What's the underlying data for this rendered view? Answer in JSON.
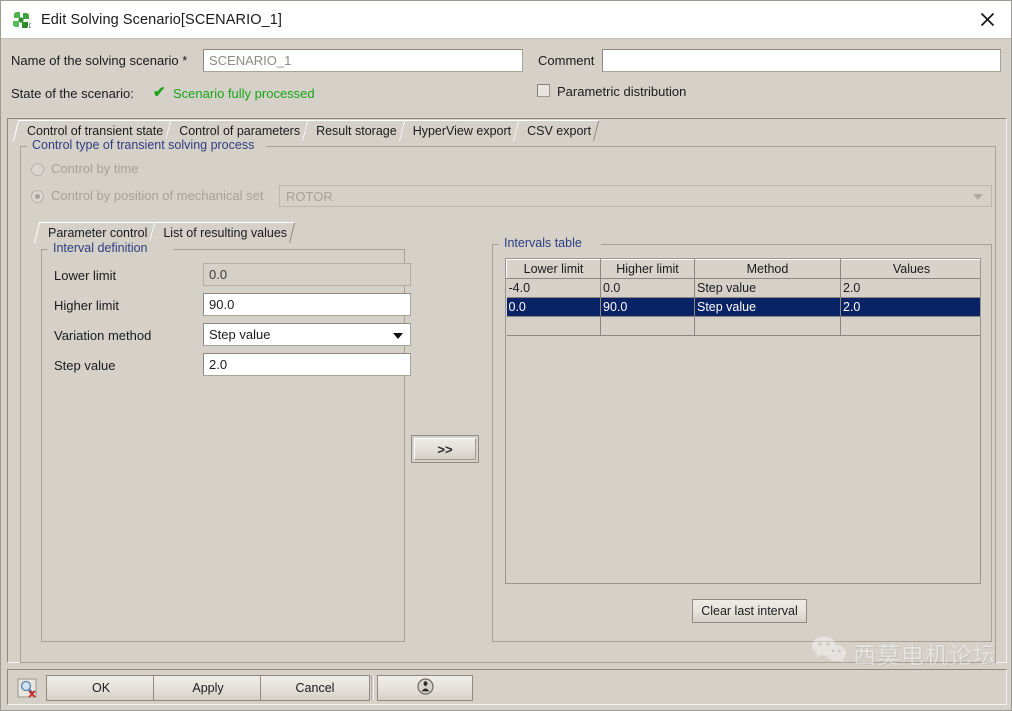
{
  "window": {
    "title": "Edit Solving Scenario[SCENARIO_1]",
    "icon": "flux-2d-pinwheel-icon",
    "close_label": "×"
  },
  "form": {
    "name_label": "Name of the solving scenario *",
    "name_value": "SCENARIO_1",
    "comment_label": "Comment",
    "comment_value": "",
    "state_label": "State of the scenario:",
    "state_check": "✔",
    "state_value": "Scenario fully processed",
    "parametric_label": "Parametric distribution",
    "parametric_checked": false
  },
  "tabs": [
    {
      "label": "Control of transient state",
      "active": true
    },
    {
      "label": "Control of parameters",
      "active": false
    },
    {
      "label": "Result storage",
      "active": false
    },
    {
      "label": "HyperView export",
      "active": false
    },
    {
      "label": "CSV export",
      "active": false
    }
  ],
  "control_type": {
    "group_title": "Control type of transient solving process",
    "radio_time_label": "Control by time",
    "radio_time_selected": false,
    "radio_position_label": "Control by position of mechanical set",
    "radio_position_selected": true,
    "mechanical_set_value": "ROTOR"
  },
  "subtabs": [
    {
      "label": "Parameter control",
      "active": true
    },
    {
      "label": "List of resulting values",
      "active": false
    }
  ],
  "interval_definition": {
    "group_title": "Interval definition",
    "fields": [
      {
        "label": "Lower limit",
        "value": "0.0",
        "type": "readonly-text"
      },
      {
        "label": "Higher limit",
        "value": "90.0",
        "type": "text"
      },
      {
        "label": "Variation method",
        "value": "Step value",
        "type": "combo"
      },
      {
        "label": "Step value",
        "value": "2.0",
        "type": "text"
      }
    ]
  },
  "transfer_button": {
    "label": ">>"
  },
  "intervals_table": {
    "group_title": "Intervals table",
    "columns": [
      "Lower limit",
      "Higher limit",
      "Method",
      "Values"
    ],
    "rows": [
      {
        "cells": [
          "-4.0",
          "0.0",
          "Step value",
          "2.0"
        ],
        "selected": false
      },
      {
        "cells": [
          "0.0",
          "90.0",
          "Step value",
          "2.0"
        ],
        "selected": true
      },
      {
        "cells": [
          "",
          "",
          "",
          ""
        ],
        "selected": false
      }
    ],
    "clear_button": "Clear last interval"
  },
  "footer": {
    "buttons": [
      "OK",
      "Apply",
      "Cancel"
    ],
    "help_icon": "help-person-icon",
    "left_icon": "reset-magnifier-icon"
  },
  "watermark": {
    "text": "西莫电机论坛",
    "logo": "wechat-icon"
  },
  "colors": {
    "dialog_bg": "#d5d1c9",
    "group_title": "#2e3d80",
    "state_green": "#17a317",
    "selection_blue": "#0a2266",
    "field_white": "#ffffff"
  }
}
